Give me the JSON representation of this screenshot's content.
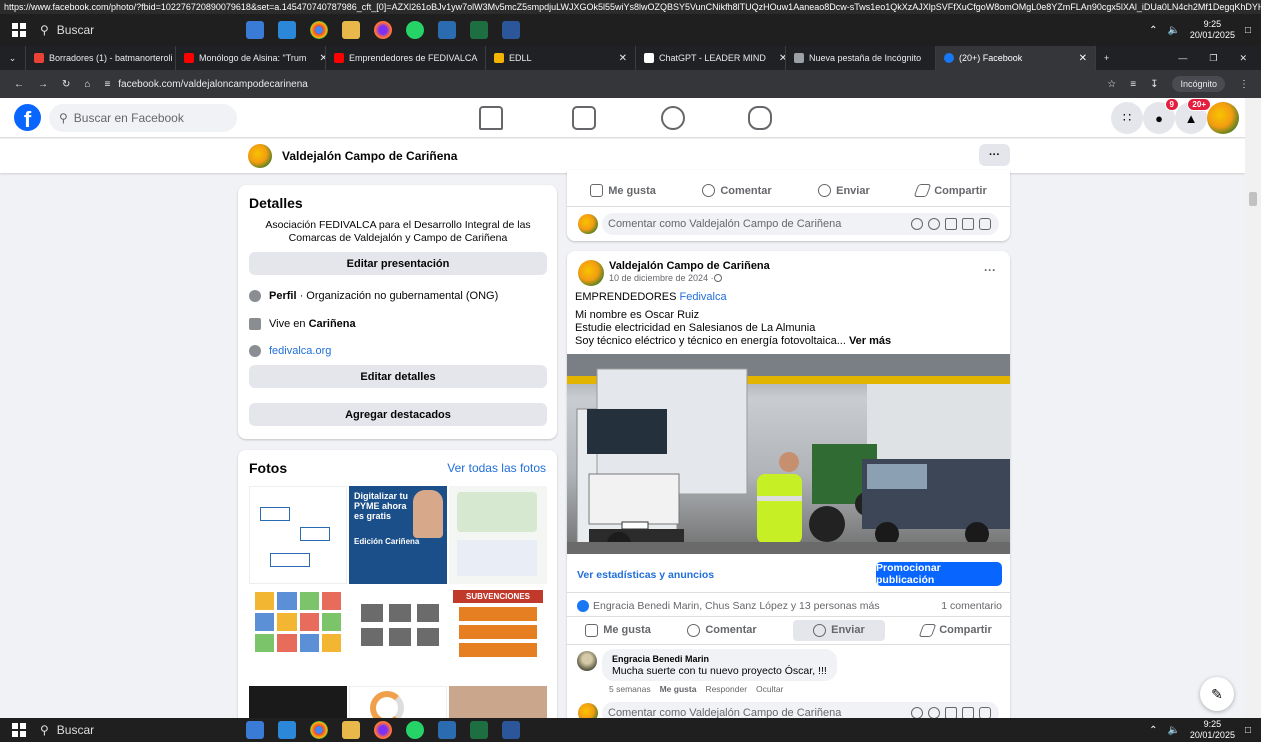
{
  "status_url": "https://www.facebook.com/photo/?fbid=102276720890079618&set=a.145470740787986_cft_[0]=AZXl261oBJv1yw7olW3Mv5mcZ5smpdjuLWJXGOk5l55wiYs8lwOZQBSY5VunCNikfh8lTUQzHOuw1Aaneao8Dcw-sTws1eo1QkXzAJXlpSVFfXuCfgoW8omOMgL0e8YZmFLAn90cgx5lXAl_iDUa0LN4ch2Mf1DegqKhDYHlgGqm2Olty_xppk8Iwujpr-8sQ&_tn_=EH-R",
  "taskbar_top": {
    "search": "Buscar",
    "time": "9:25",
    "date": "20/01/2025"
  },
  "tabs": [
    {
      "title": "Borradores (1) - batmanorteroli",
      "color": "#ea4335"
    },
    {
      "title": "Monólogo de Alsina: \"Trum",
      "color": "#ff0000"
    },
    {
      "title": "Emprendedores de FEDIVALCA",
      "color": "#ff0000"
    },
    {
      "title": "EDLL",
      "color": "#f4b400"
    },
    {
      "title": "ChatGPT - LEADER MIND",
      "color": "#ffffff"
    },
    {
      "title": "Nueva pestaña de Incógnito",
      "color": "#9aa0a6"
    },
    {
      "title": "(20+) Facebook",
      "color": "#1877f2"
    }
  ],
  "address_bar": {
    "url": "facebook.com/valdejaloncampodecarinena",
    "incognito_label": "Incógnito"
  },
  "fb_nav": {
    "search_placeholder": "Buscar en Facebook",
    "messenger_badge": "9",
    "notifications_badge": "20+"
  },
  "page_header": {
    "name": "Valdejalón Campo de Cariñena",
    "more": "···"
  },
  "details": {
    "heading": "Detalles",
    "bio": "Asociación FEDIVALCA para el Desarrollo Integral de las Comarcas de Valdejalón y Campo de Cariñena",
    "edit_bio_button": "Editar presentación",
    "profile_label": "Perfil",
    "profile_value": " · Organización no gubernamental (ONG)",
    "lives_prefix": "Vive en ",
    "lives_city": "Cariñena",
    "website": "fedivalca.org",
    "edit_details_button": "Editar detalles",
    "add_featured_button": "Agregar destacados"
  },
  "photos": {
    "heading": "Fotos",
    "see_all": "Ver todas las fotos",
    "tile2_title": "Digitalizar tu PYME ahora es gratis",
    "tile2_sub": "Edición Cariñena",
    "tile6_title": "SUBVENCIONES"
  },
  "top_post_actions": {
    "like": "Me gusta",
    "comment": "Comentar",
    "send": "Enviar",
    "share": "Compartir"
  },
  "comment_placeholder": "Comentar como Valdejalón Campo de Cariñena",
  "post": {
    "author": "Valdejalón Campo de Cariñena",
    "date": "10 de diciembre de 2024 · ",
    "line1_prefix": "EMPRENDEDORES ",
    "line1_tag": "Fedivalca",
    "line2": "Mi nombre es Oscar Ruiz",
    "line3": "Estudie electricidad en Salesianos de La Almunia",
    "line4": "Soy técnico eléctrico y técnico en energía fotovoltaica... ",
    "see_more": "Ver más",
    "stats_link": "Ver estadísticas y anuncios",
    "promote_button": "Promocionar publicación",
    "reactions": "Engracia Benedi Marin, Chus Sanz López y 13 personas más",
    "comment_count": "1 comentario",
    "like": "Me gusta",
    "comment": "Comentar",
    "send": "Enviar",
    "share": "Compartir"
  },
  "comment": {
    "author": "Engracia Benedi Marin",
    "text": "Mucha suerte con tu nuevo proyecto Óscar, !!!",
    "time": "5 semanas",
    "like": "Me gusta",
    "reply": "Responder",
    "hide": "Ocultar"
  },
  "taskbar_bottom": {
    "search": "Buscar",
    "time": "9:25",
    "date": "20/01/2025"
  },
  "colors": {
    "facebook_blue": "#0866ff",
    "link_blue": "#216fdb",
    "badge_red": "#e41e3f"
  }
}
